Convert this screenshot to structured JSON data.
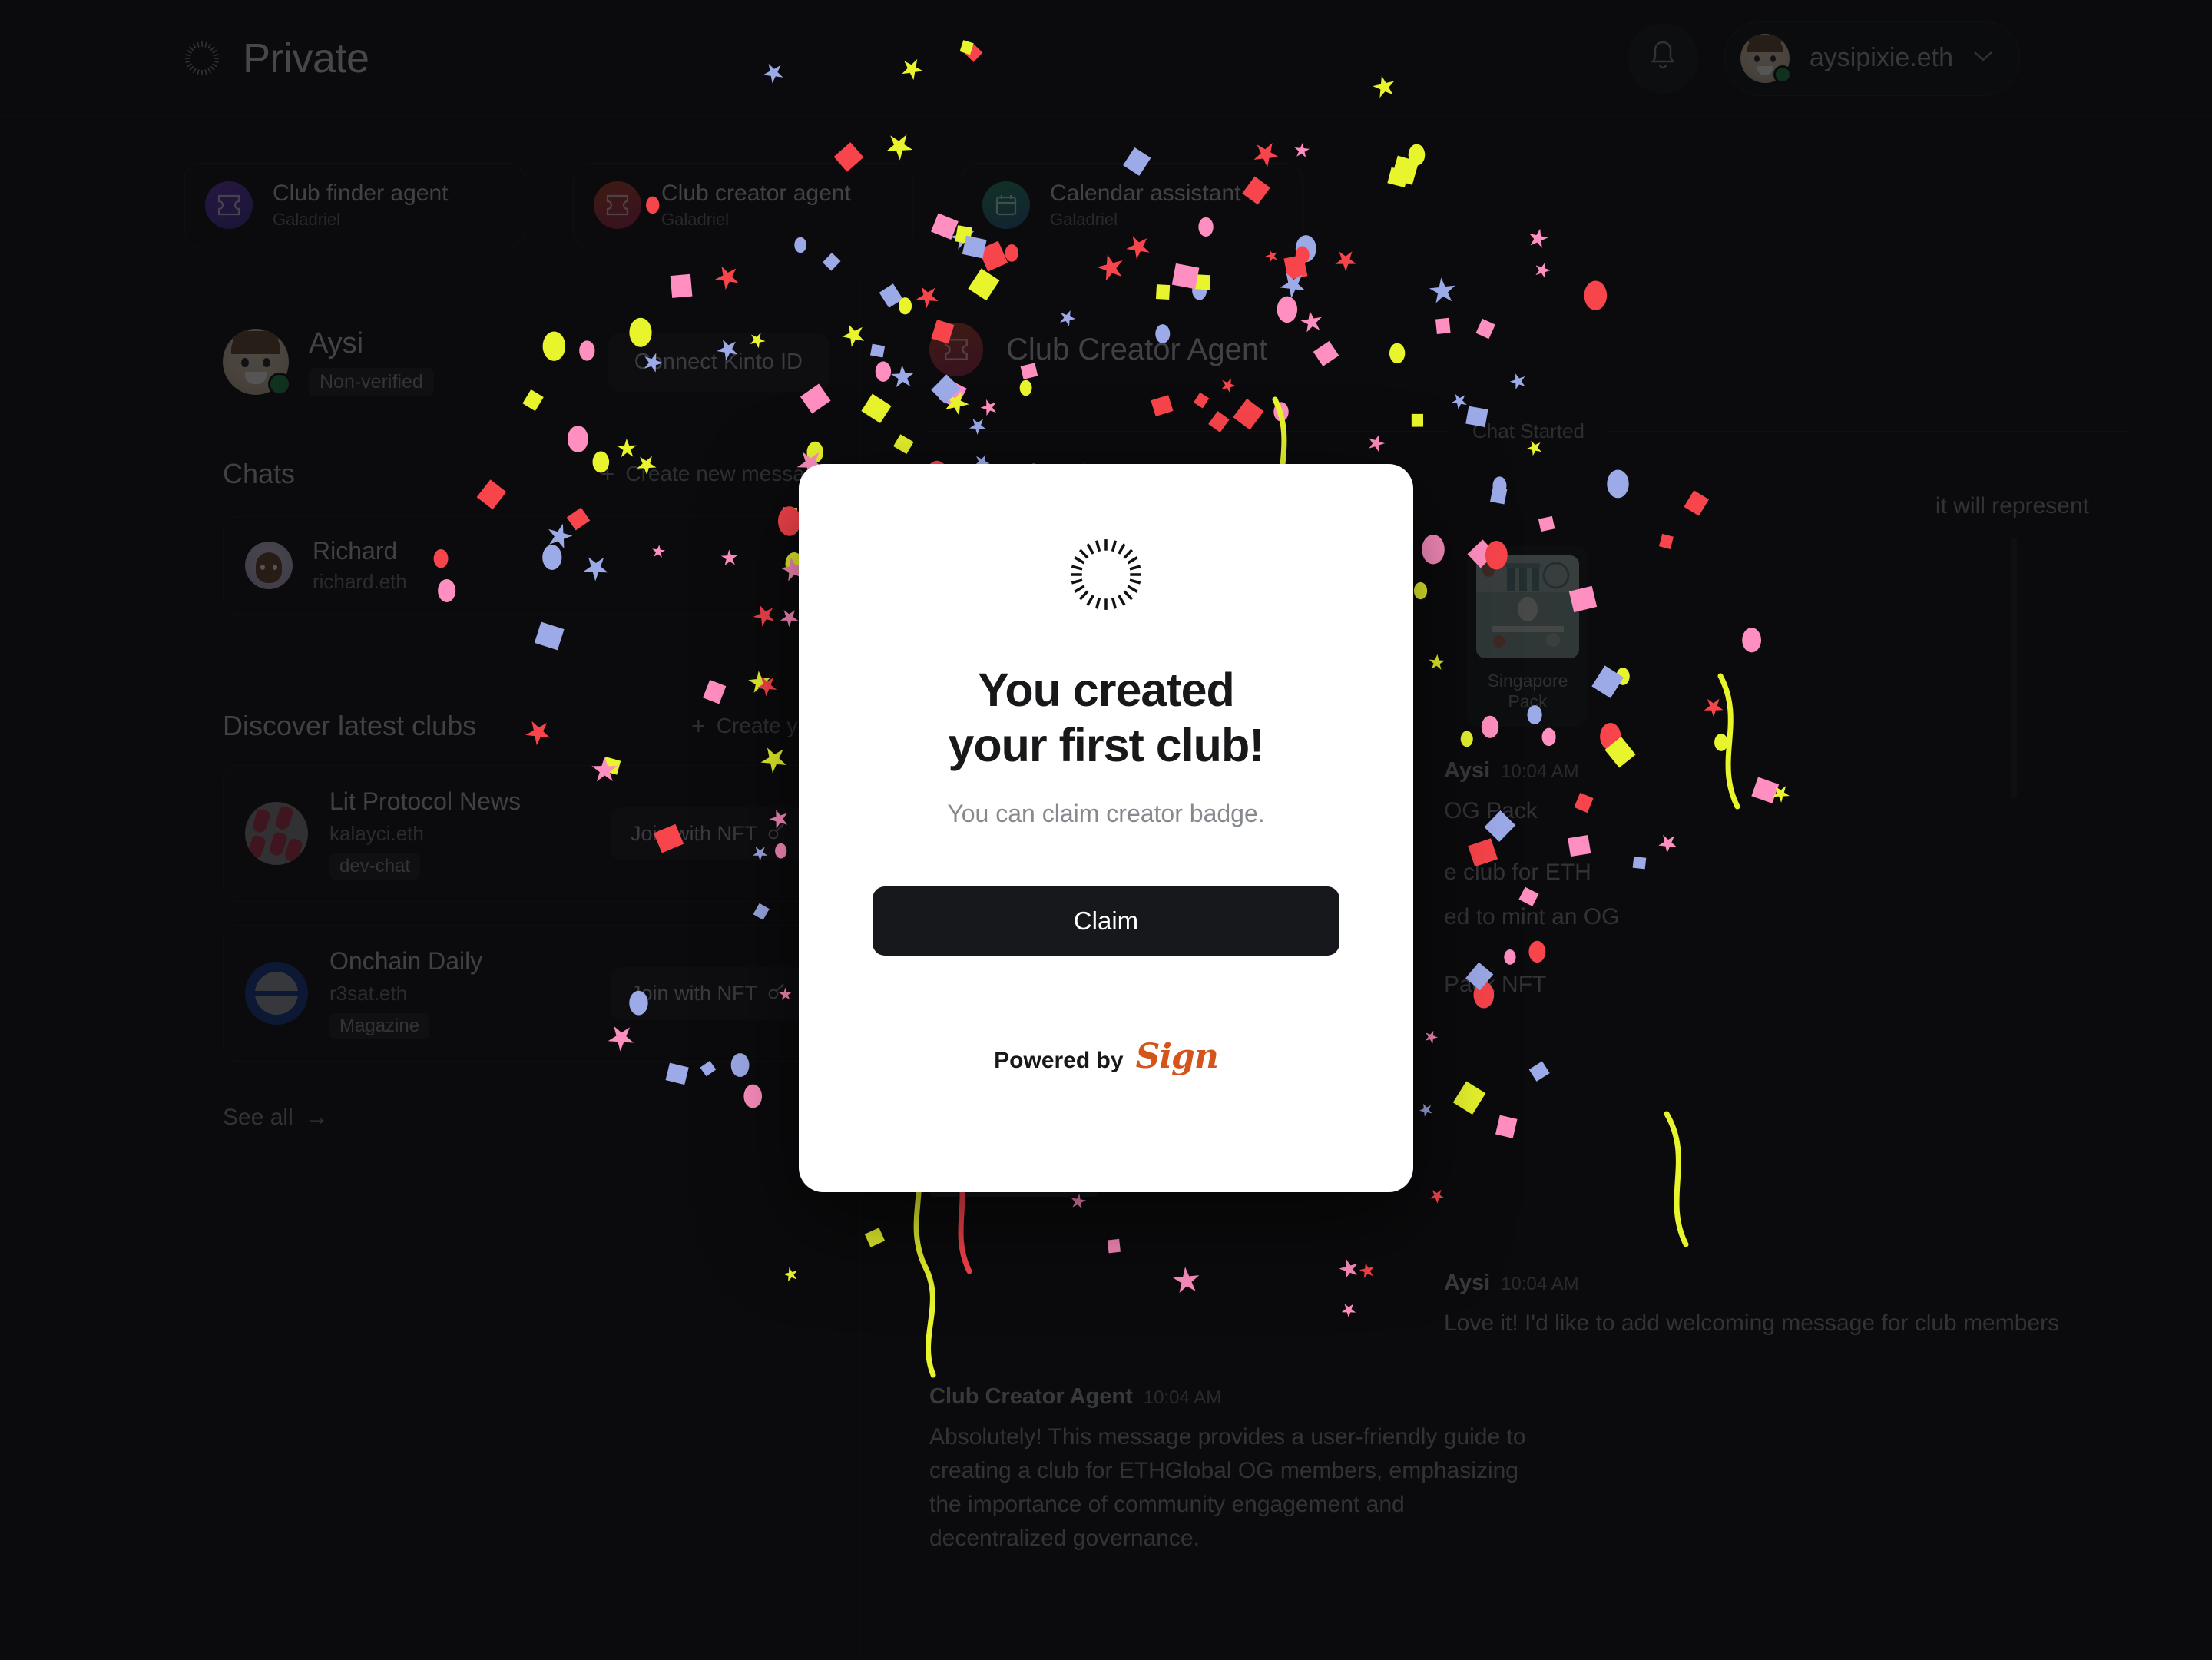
{
  "header": {
    "brand_title": "Private",
    "logo_icon": "radial-burst-icon",
    "bell_icon": "bell-icon",
    "user": {
      "name": "aysipixie.eth",
      "chevron_icon": "chevron-down-icon",
      "avatar_icon": "user-avatar",
      "status": "online"
    }
  },
  "agents": [
    {
      "name": "Club finder agent",
      "provider": "Galadriel",
      "icon": "ticket-icon",
      "tone": "purple"
    },
    {
      "name": "Club creator agent",
      "provider": "Galadriel",
      "icon": "ticket-icon",
      "tone": "red"
    },
    {
      "name": "Calendar assistant",
      "provider": "Galadriel",
      "icon": "calendar-icon",
      "tone": "green"
    }
  ],
  "sidebar": {
    "profile": {
      "name": "Aysi",
      "badge": "Non-verified",
      "connect_button": "Connect Kinto ID"
    },
    "chats": {
      "title": "Chats",
      "action": "Create new message",
      "action_icon": "plus-icon",
      "items": [
        {
          "name": "Richard",
          "handle": "richard.eth"
        }
      ]
    },
    "discover": {
      "title": "Discover latest clubs",
      "action": "Create your",
      "action_icon": "plus-icon",
      "items": [
        {
          "name": "Lit Protocol News",
          "handle": "kalayci.eth",
          "tag": "dev-chat",
          "join_label": "Join with NFT",
          "join_icon": "key-icon"
        },
        {
          "name": "Onchain Daily",
          "handle": "r3sat.eth",
          "tag": "Magazine",
          "join_label": "Join with NFT",
          "join_icon": "key-icon"
        }
      ]
    },
    "see_all": "See all",
    "see_all_icon": "arrow-right-icon"
  },
  "chat": {
    "title": "Club Creator Agent",
    "title_icon": "ticket-icon",
    "started_label": "Chat Started",
    "fragment_top": "it will represent",
    "nft_cards": [
      {
        "caption": "Singapore Pack"
      }
    ],
    "messages": [
      {
        "who": "Aysi",
        "time": "10:04 AM",
        "text": "OG Pack"
      },
      {
        "who": "",
        "time": "",
        "text": "e club for ETH"
      },
      {
        "who": "",
        "time": "",
        "text": "ed to mint an OG"
      },
      {
        "who": "",
        "time": "",
        "text": "Pack NFT"
      },
      {
        "who": "Aysi",
        "time": "10:04 AM",
        "text": "Love it! I'd like to add welcoming message for club members"
      },
      {
        "who": "Club Creator Agent",
        "time": "10:04 AM",
        "text": "Absolutely! This message provides a user-friendly guide to creating a club for ETHGlobal OG members, emphasizing the importance of community engagement and decentralized governance."
      }
    ]
  },
  "modal": {
    "logo_icon": "radial-burst-icon",
    "title_line1": "You created",
    "title_line2": "your first club!",
    "subtitle": "You can claim creator badge.",
    "claim_label": "Claim",
    "powered_by": "Powered by",
    "powered_brand": "Sign"
  },
  "colors": {
    "page_bg": "#0b0b0d",
    "modal_bg": "#ffffff",
    "claim_bg": "#17181c",
    "sign_brand": "#d4541b",
    "confetti_yellow": "#e8f52d",
    "confetti_pink": "#ff8fc0",
    "confetti_red": "#f8444b",
    "confetti_blue": "#9daae8",
    "status_green": "#1c8a42"
  }
}
